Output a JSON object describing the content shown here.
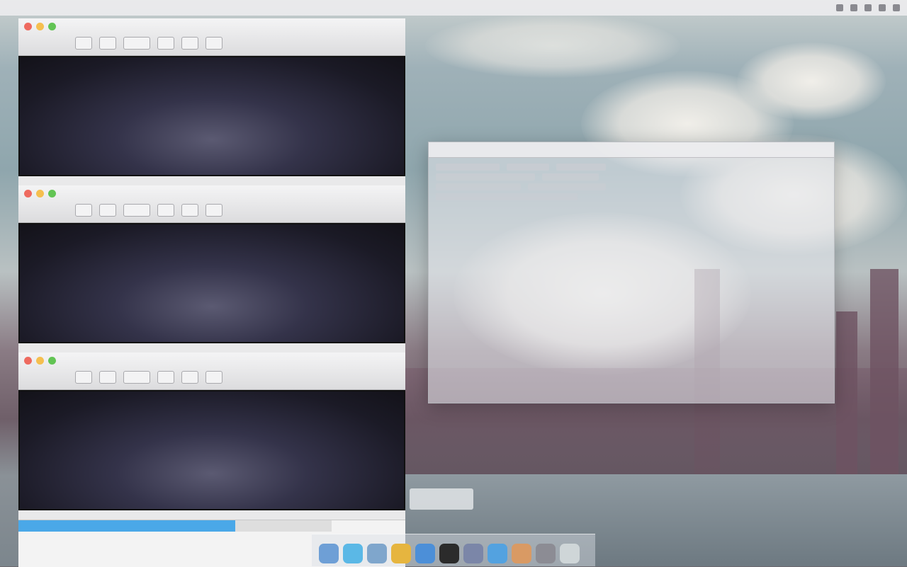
{
  "menubar": {
    "apple": "",
    "app": "",
    "items": [
      "",
      "",
      "",
      "",
      ""
    ]
  },
  "terminals": [
    {
      "title": "",
      "content": ""
    },
    {
      "title": "",
      "content": ""
    },
    {
      "title": "",
      "content": ""
    }
  ],
  "statusbar": {
    "tabs": [
      "",
      ""
    ]
  },
  "float_window": {
    "title_items": [
      "",
      "",
      "",
      ""
    ]
  },
  "dock": {
    "icons": [
      "finder-icon",
      "safari-icon",
      "mail-icon",
      "chrome-icon",
      "app-store-icon",
      "terminal-icon",
      "itunes-icon",
      "messages-icon",
      "photos-icon",
      "preferences-icon",
      "trash-icon"
    ],
    "colors": [
      "#6e9fd6",
      "#5bb8e6",
      "#7fa6cc",
      "#e6b53f",
      "#4c8fd8",
      "#2b2b2b",
      "#7b86a8",
      "#53a2e0",
      "#d99a64",
      "#8c8c94",
      "#cfd6d8"
    ]
  },
  "desktop": {
    "corner_text": ""
  }
}
